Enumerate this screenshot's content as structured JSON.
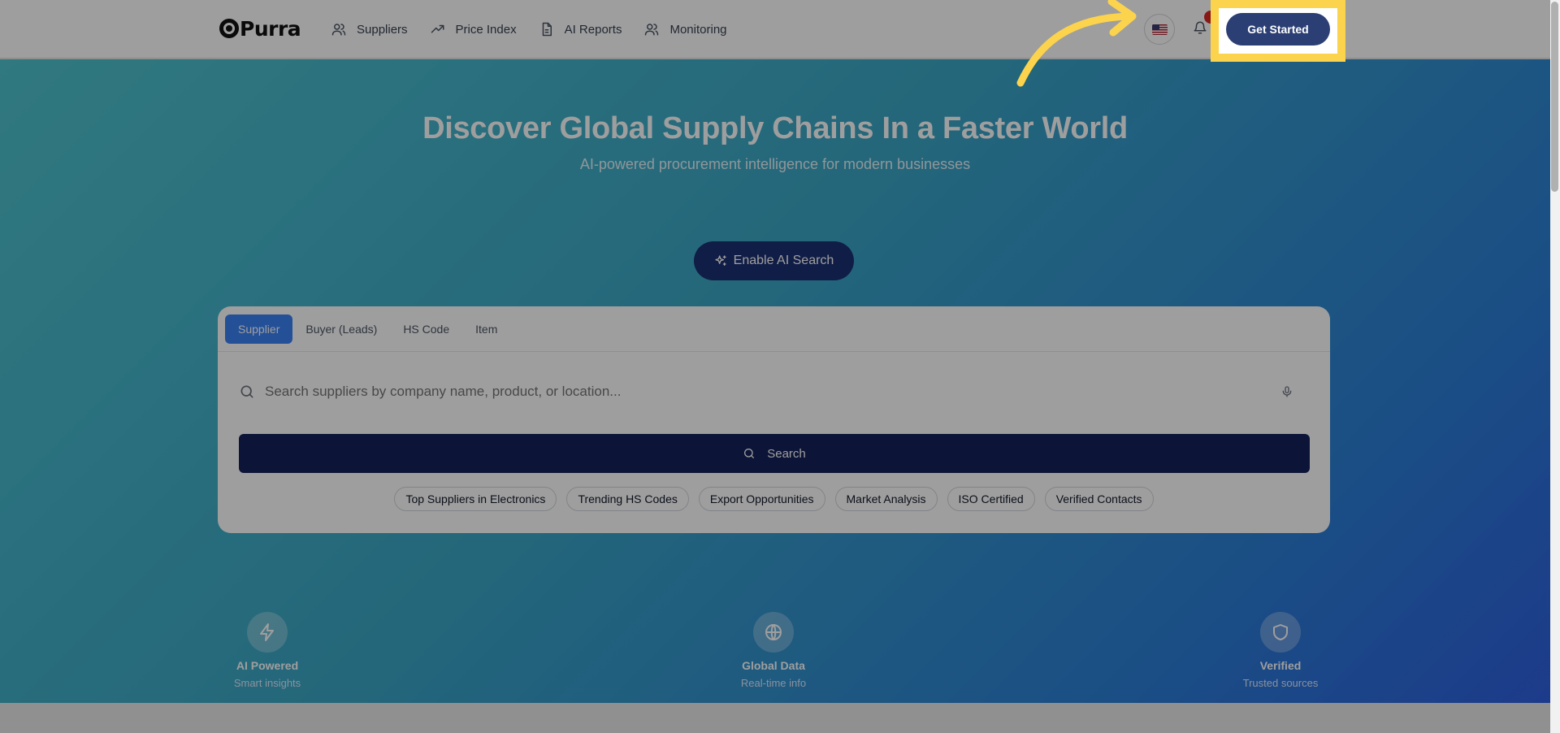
{
  "brand": {
    "name": "Purra"
  },
  "nav": {
    "items": [
      {
        "label": "Suppliers",
        "icon": "users-icon"
      },
      {
        "label": "Price Index",
        "icon": "trending-up-icon"
      },
      {
        "label": "AI Reports",
        "icon": "document-icon"
      },
      {
        "label": "Monitoring",
        "icon": "user-monitor-icon"
      }
    ]
  },
  "header": {
    "language": "US flag",
    "get_started": "Get Started"
  },
  "hero": {
    "title": "Discover Global Supply Chains In a Faster World",
    "subtitle": "AI-powered procurement intelligence for modern businesses",
    "ai_button": "Enable AI Search"
  },
  "search": {
    "tabs": [
      "Supplier",
      "Buyer (Leads)",
      "HS Code",
      "Item"
    ],
    "active_tab": "Supplier",
    "placeholder": "Search suppliers by company name, product, or location...",
    "button": "Search",
    "chips": [
      "Top Suppliers in Electronics",
      "Trending HS Codes",
      "Export Opportunities",
      "Market Analysis",
      "ISO Certified",
      "Verified Contacts"
    ]
  },
  "features": [
    {
      "title": "AI Powered",
      "subtitle": "Smart insights",
      "icon": "lightning-icon"
    },
    {
      "title": "Global Data",
      "subtitle": "Real-time info",
      "icon": "globe-icon"
    },
    {
      "title": "Verified",
      "subtitle": "Trusted sources",
      "icon": "shield-icon"
    }
  ],
  "colors": {
    "highlight": "#fcd34d",
    "brand_navy": "#14215a",
    "accent_blue": "#3b82f6"
  }
}
